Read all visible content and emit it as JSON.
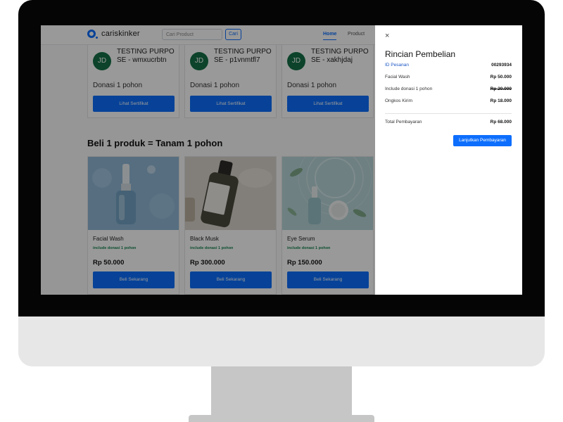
{
  "site": {
    "brand": "cariskinker",
    "search_placeholder": "Cari Product",
    "search_button": "Cari",
    "nav": {
      "home": "Home",
      "product": "Product"
    }
  },
  "certificates": [
    {
      "initials": "JD",
      "name": "TESTING PURPOSE - wmxucrbtn",
      "donation": "Donasi 1 pohon",
      "button": "Lihat Sertifikat"
    },
    {
      "initials": "JD",
      "name": "TESTING PURPOSE - p1vnmtfl7",
      "donation": "Donasi 1 pohon",
      "button": "Lihat Sertifikat"
    },
    {
      "initials": "JD",
      "name": "TESTING PURPOSE - xakhjdaj",
      "donation": "Donasi 1 pohon",
      "button": "Lihat Sertifikat"
    }
  ],
  "section_title": "Beli 1 produk = Tanam 1 pohon",
  "products": [
    {
      "name": "Facial Wash",
      "donation": "include donasi 1 pohon",
      "price": "Rp 50.000",
      "button": "Beli Sekarang"
    },
    {
      "name": "Black Musk",
      "donation": "include donasi 1 pohon",
      "price": "Rp 300.000",
      "button": "Beli Sekarang"
    },
    {
      "name": "Eye Serum",
      "donation": "include donasi 1 pohon",
      "price": "Rp 150.000",
      "button": "Beli Sekarang"
    }
  ],
  "panel": {
    "close": "×",
    "title": "Rincian Pembelian",
    "rows": [
      {
        "label": "ID Pesanan",
        "value": "00293934"
      },
      {
        "label": "Facial Wash",
        "value": "Rp 50.000"
      },
      {
        "label": "Include donasi 1 pohon",
        "value": "Rp 20.000"
      },
      {
        "label": "Ongkos Kirim",
        "value": "Rp 18.000"
      }
    ],
    "total_label": "Total Pembayaran",
    "total_value": "Rp 68.000",
    "continue_button": "Lanjutkan Pembayaran"
  },
  "colors": {
    "primary": "#0d6efd",
    "avatar": "#157046",
    "donation_text": "#198754"
  }
}
